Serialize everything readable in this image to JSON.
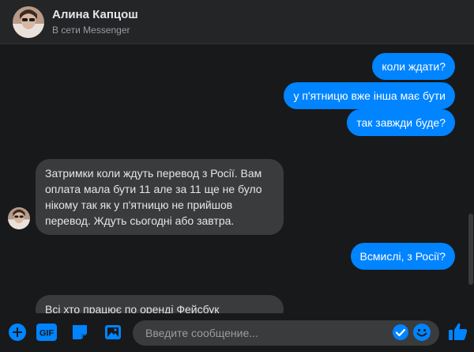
{
  "header": {
    "name": "Алина Капцош",
    "status": "В сети Messenger"
  },
  "messages": [
    {
      "dir": "out",
      "text": "коли ждати?"
    },
    {
      "dir": "out",
      "text": "у п'ятницю вже інша має бути"
    },
    {
      "dir": "out",
      "text": "так завжди буде?"
    },
    {
      "dir": "in",
      "text": "Затримки коли ждуть перевод з Росії. Вам оплата мала бути 11 але за 11 ще не було нікому так як у п'ятницю не прийшов перевод. Ждуть сьогодні або завтра."
    },
    {
      "dir": "out",
      "text": "Всмислі, з Росії?"
    },
    {
      "dir": "in",
      "text": "Всі хто працює по оренді Фейсбук"
    }
  ],
  "composer": {
    "placeholder": "Введите сообщение...",
    "gif_label": "GIF"
  },
  "colors": {
    "accent": "#0084ff",
    "background": "#18191b",
    "incoming_bubble": "#3a3b3c"
  },
  "icons": [
    "plus-circle-icon",
    "gif-icon",
    "sticker-icon",
    "image-icon",
    "check-circle-icon",
    "emoji-icon",
    "like-icon"
  ]
}
